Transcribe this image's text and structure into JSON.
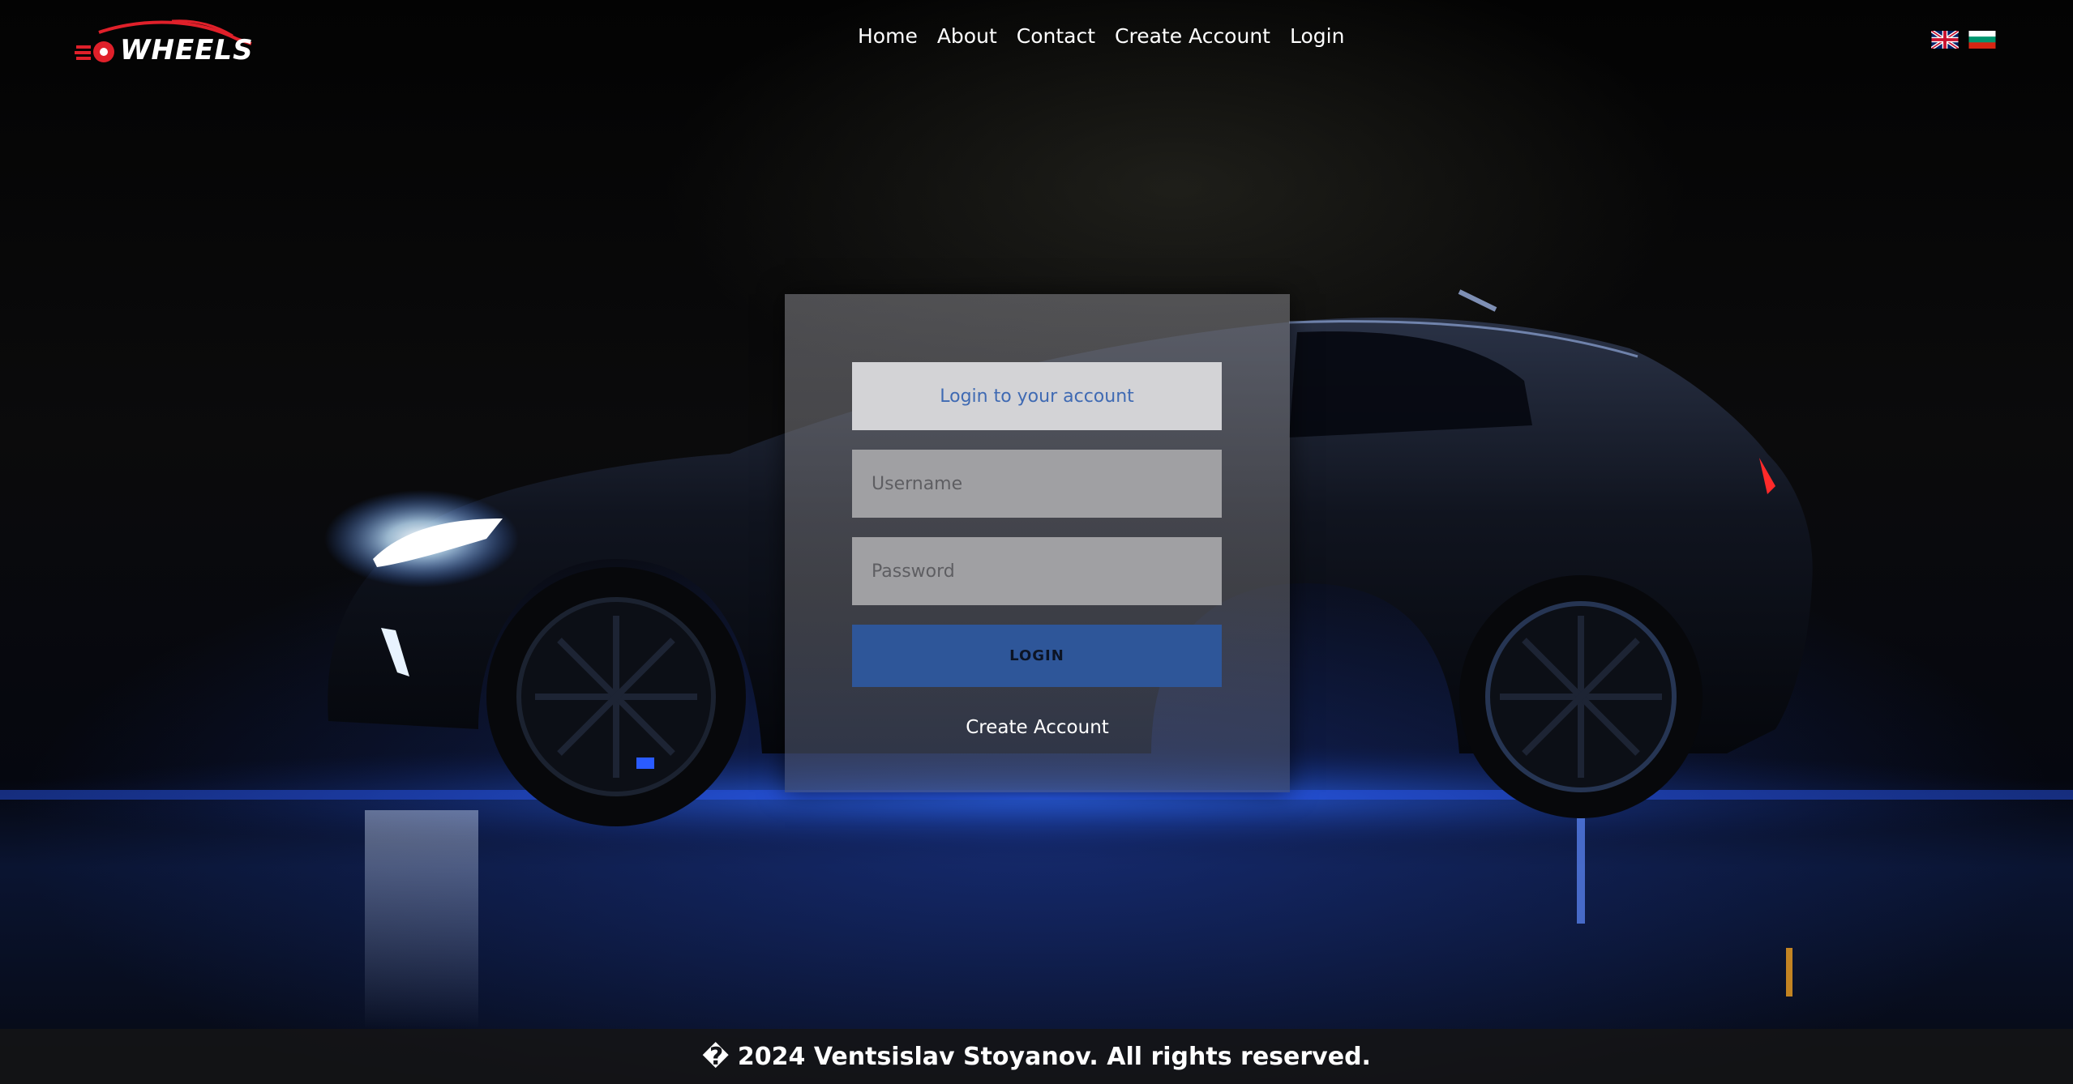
{
  "brand": {
    "name": "WHEELS"
  },
  "nav": {
    "items": [
      {
        "label": "Home"
      },
      {
        "label": "About"
      },
      {
        "label": "Contact"
      },
      {
        "label": "Create Account"
      },
      {
        "label": "Login"
      }
    ]
  },
  "languages": [
    {
      "name": "English",
      "icon": "uk-flag-icon"
    },
    {
      "name": "Bulgarian",
      "icon": "bulgaria-flag-icon"
    }
  ],
  "login_form": {
    "title": "Login to your account",
    "username_placeholder": "Username",
    "username_value": "",
    "password_placeholder": "Password",
    "password_value": "",
    "submit_label": "LOGIN",
    "create_account_label": "Create Account"
  },
  "footer": {
    "text": "� 2024 Ventsislav Stoyanov. All rights reserved."
  },
  "colors": {
    "accent": "#2e5699",
    "title_text": "#3f6ab3",
    "logo_red": "#e0202a"
  }
}
